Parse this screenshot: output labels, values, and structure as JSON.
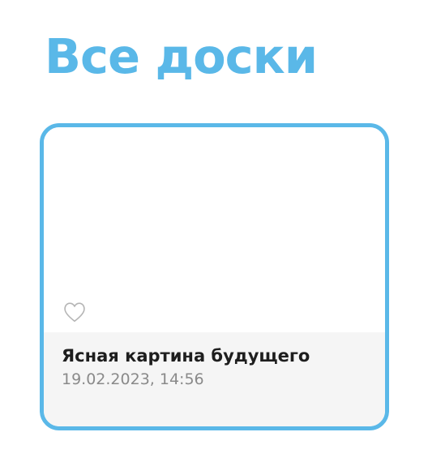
{
  "colors": {
    "accent": "#5ab8e8",
    "title_text": "#1e1e1e",
    "date_text": "#8a8a8a",
    "info_background": "#f5f5f5",
    "heart_outline": "#b5b5b5"
  },
  "header": {
    "title": "Все доски"
  },
  "boards": [
    {
      "name": "Ясная картина будущего",
      "date": "19.02.2023, 14:56",
      "favorite_icon": "heart-outline-icon",
      "is_favorite": false
    }
  ]
}
